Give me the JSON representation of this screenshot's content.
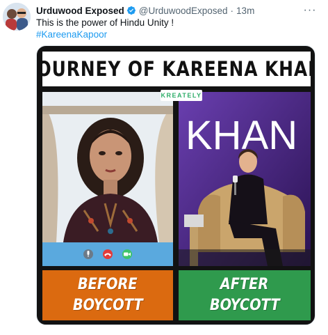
{
  "post": {
    "display_name": "Urduwood Exposed",
    "handle": "@UrduwoodExposed",
    "separator": "·",
    "time": "13m",
    "text": "This is the power of Hindu Unity !",
    "hashtag": "#KareenaKapoor",
    "verified_icon": "verified-badge-icon",
    "more_icon": "more-options-icon",
    "more_glyph": "···"
  },
  "media": {
    "title": "JOURNEY OF KAREENA KHAN",
    "watermark": "KREATELY",
    "left_backdrop_text": "",
    "right_backdrop_text": "KHAN",
    "before_label_line1": "BEFORE",
    "before_label_line2": "BOYCOTT",
    "after_label_line1": "AFTER",
    "after_label_line2": "BOYCOTT",
    "call_icons": [
      "microphone-icon",
      "end-call-icon",
      "camera-icon"
    ],
    "colors": {
      "before": "#db6a10",
      "after": "#2f9a4d",
      "call_bar": "#5aa9de",
      "stage": "#1b0e3c"
    }
  },
  "colors": {
    "link": "#1d9bf0",
    "text": "#0f1419",
    "muted": "#536471",
    "verified": "#1d9bf0"
  }
}
